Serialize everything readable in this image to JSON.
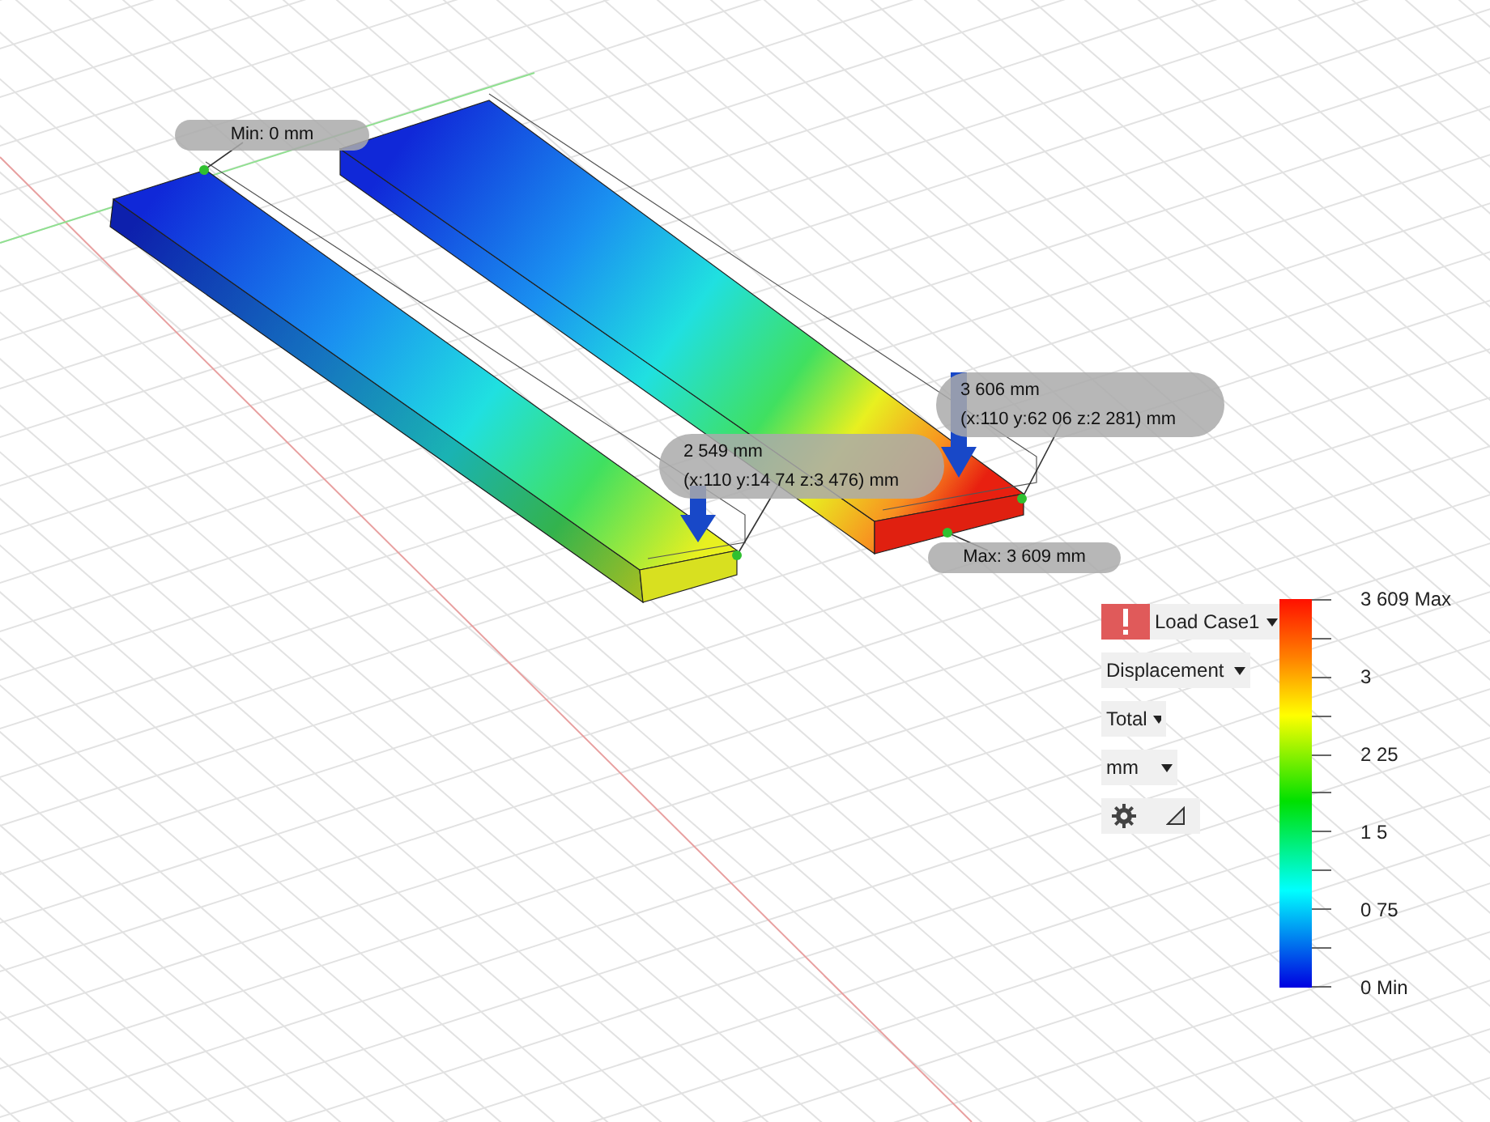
{
  "callouts": [
    {
      "kind": "min",
      "lines": [
        "Min: 0 mm"
      ]
    },
    {
      "kind": "probe",
      "lines": [
        "2 549 mm",
        "(x:110 y:14 74 z:3 476) mm"
      ]
    },
    {
      "kind": "probe",
      "lines": [
        "3 606 mm",
        "(x:110 y:62 06 z:2 281) mm"
      ]
    },
    {
      "kind": "max",
      "lines": [
        "Max: 3 609 mm"
      ]
    }
  ],
  "panel": {
    "load_case": {
      "label": "Load Case1",
      "warning": true
    },
    "dropdowns": [
      {
        "label": "Displacement"
      },
      {
        "label": "Total"
      },
      {
        "label": "mm"
      }
    ]
  },
  "legend": {
    "ticks": [
      "3 609 Max",
      "3",
      "2 25",
      "1 5",
      "0 75",
      "0 Min"
    ]
  }
}
